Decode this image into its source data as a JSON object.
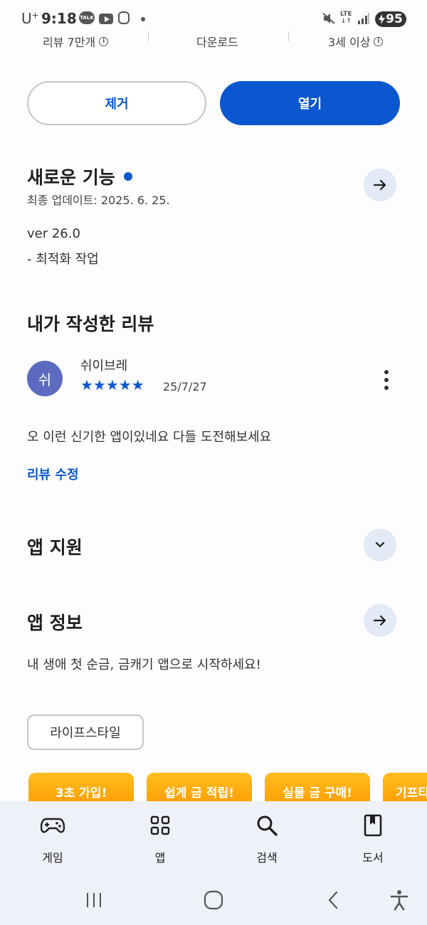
{
  "status_bar": {
    "carrier": "U",
    "carrier_sup": "+",
    "time": "9:18",
    "talk_badge": "TALK",
    "network": "LTE",
    "battery": "95"
  },
  "stats": {
    "reviews": "리뷰 7만개",
    "downloads": "다운로드",
    "age_rating": "3세 이상",
    "info_glyph": "i"
  },
  "actions": {
    "remove_label": "제거",
    "open_label": "열기"
  },
  "whats_new": {
    "title": "새로운 기능",
    "updated": "최종 업데이트: 2025. 6. 25.",
    "version": "ver 26.0",
    "note": "- 최적화 작업"
  },
  "my_review": {
    "title": "내가 작성한 리뷰",
    "avatar_initial": "쉬",
    "author": "쉬이브레",
    "rating": 5,
    "stars": "★★★★★",
    "date": "25/7/27",
    "text": "오 이런 신기한 앱이있네요 다들 도전해보세요",
    "edit_label": "리뷰 수정"
  },
  "app_support": {
    "title": "앱 지원"
  },
  "app_info": {
    "title": "앱 정보",
    "description": "내 생애 첫 순금, 금캐기 앱으로 시작하세요!",
    "category_chip": "라이프스타일"
  },
  "promos": [
    "3초 가입!",
    "쉽게 금 적립!",
    "실물 금 구매!",
    "기프티"
  ],
  "bottom_nav": {
    "games": "게임",
    "apps": "앱",
    "search": "검색",
    "books": "도서"
  },
  "colors": {
    "accent": "#0b57d0",
    "avatar": "#5c6bc0",
    "promo": "#ffab00",
    "nav_bg": "#eef1f7"
  }
}
